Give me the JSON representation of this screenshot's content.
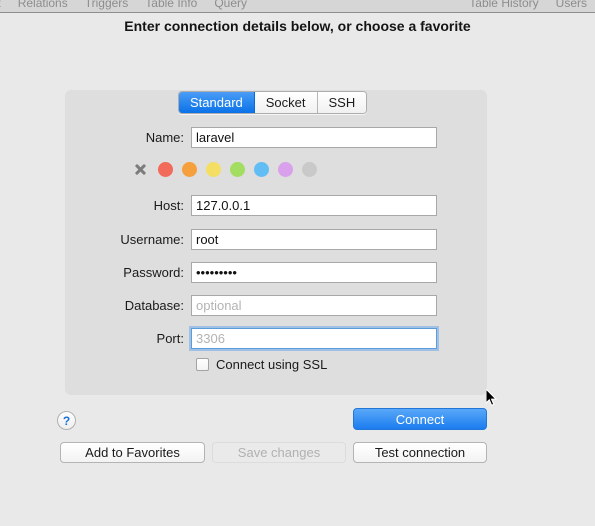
{
  "toolbar": {
    "left_items": [
      "ent",
      "Relations",
      "Triggers",
      "Table Info",
      "Query"
    ],
    "right_items": [
      "Table History",
      "Users"
    ]
  },
  "headline": "Enter connection details below, or choose a favorite",
  "tabs": [
    {
      "label": "Standard",
      "selected": true
    },
    {
      "label": "Socket",
      "selected": false
    },
    {
      "label": "SSH",
      "selected": false
    }
  ],
  "fields": {
    "name": {
      "label": "Name:",
      "value": "laravel",
      "placeholder": ""
    },
    "host": {
      "label": "Host:",
      "value": "127.0.0.1",
      "placeholder": ""
    },
    "username": {
      "label": "Username:",
      "value": "root",
      "placeholder": ""
    },
    "password": {
      "label": "Password:",
      "value": "•••••••••",
      "placeholder": ""
    },
    "database": {
      "label": "Database:",
      "value": "",
      "placeholder": "optional"
    },
    "port": {
      "label": "Port:",
      "value": "",
      "placeholder": "3306",
      "focused": true
    }
  },
  "color_swatches": {
    "clear_label": "x",
    "colors": [
      "#f26a5a",
      "#f5a03c",
      "#f4de63",
      "#a3dd62",
      "#63bdf5",
      "#d9a0ec",
      "#c9c9c9"
    ]
  },
  "ssl_checkbox": {
    "label": "Connect using SSL",
    "checked": false
  },
  "buttons": {
    "help": "?",
    "connect": "Connect",
    "add_to_favorites": "Add to Favorites",
    "save_changes": "Save changes",
    "test_connection": "Test connection"
  },
  "colors": {
    "page_background": "#e9e9e9",
    "panel_background": "#dedede",
    "toolbar_background": "#d6d6d6",
    "accent_blue": "#1b7cef",
    "focus_ring": "#5b9ddb",
    "disabled_text": "#b1b1b1"
  }
}
